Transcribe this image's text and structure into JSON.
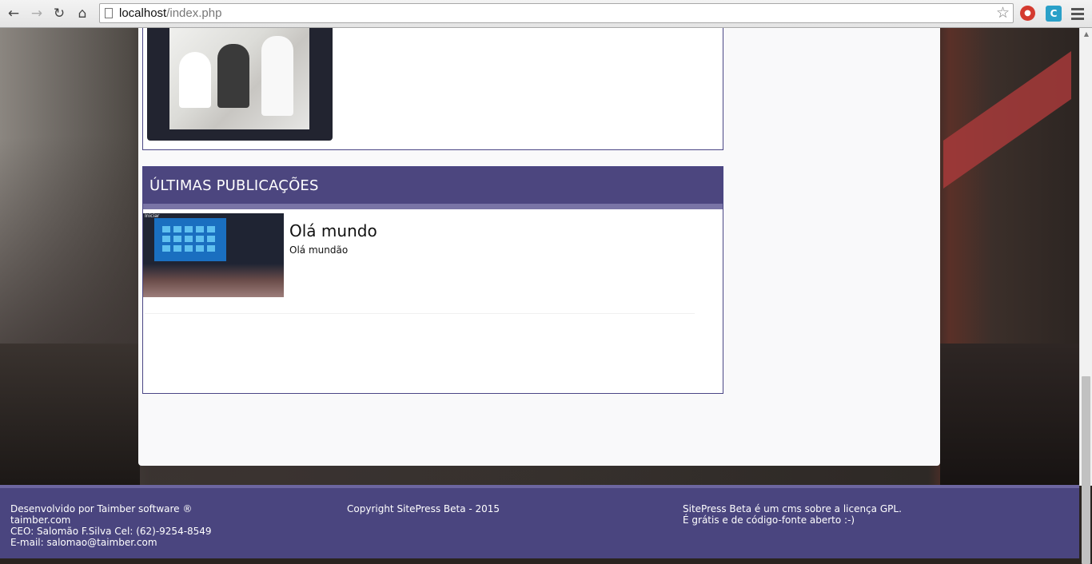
{
  "browser": {
    "url_host": "localhost",
    "url_path": "/index.php",
    "back_icon": "back-arrow-icon",
    "forward_icon": "forward-arrow-icon",
    "reload_icon": "reload-icon",
    "home_icon": "home-icon"
  },
  "section": {
    "title": "ÚLTIMAS PUBLICAÇÕES"
  },
  "posts": [
    {
      "title": "Olá mundo",
      "excerpt": "Olá mundão",
      "thumb_text": "Iniciar"
    }
  ],
  "footer": {
    "col1": [
      "Desenvolvido por Taimber software ®",
      "taimber.com",
      "CEO: Salomão F.Silva Cel: (62)-9254-8549",
      "E-mail: salomao@taimber.com"
    ],
    "col2": [
      "Copyright SitePress Beta - 2015"
    ],
    "col3": [
      "SitePress Beta é um cms sobre a licença GPL.",
      "É grátis e de código-fonte aberto :-)"
    ]
  },
  "colors": {
    "header_purple": "#4c467f",
    "footer_purple": "#4a457f"
  }
}
